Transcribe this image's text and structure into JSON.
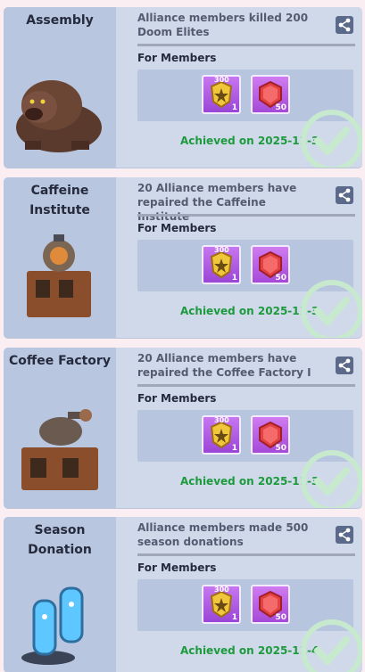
{
  "cards": [
    {
      "name": "Assembly",
      "description": "Alliance members killed 200 Doom Elites",
      "for_label": "For Members",
      "rewards": [
        {
          "icon": "badge-icon",
          "top": "300",
          "qty": "1"
        },
        {
          "icon": "red-gem-icon",
          "qty": "50"
        }
      ],
      "achieved": "Achieved on 2025-11-3"
    },
    {
      "name": "Caffeine Institute",
      "description": "20 Alliance members have repaired the Caffeine Institute",
      "for_label": "For Members",
      "rewards": [
        {
          "icon": "badge-icon",
          "top": "300",
          "qty": "1"
        },
        {
          "icon": "red-gem-icon",
          "qty": "50"
        }
      ],
      "achieved": "Achieved on 2025-11-3"
    },
    {
      "name": "Coffee Factory",
      "description": "20 Alliance members have repaired the Coffee Factory I",
      "for_label": "For Members",
      "rewards": [
        {
          "icon": "badge-icon",
          "top": "300",
          "qty": "1"
        },
        {
          "icon": "red-gem-icon",
          "qty": "50"
        }
      ],
      "achieved": "Achieved on 2025-11-3"
    },
    {
      "name": "Season Donation",
      "description": "Alliance members made 500 season donations",
      "for_label": "For Members",
      "rewards": [
        {
          "icon": "badge-icon",
          "top": "300",
          "qty": "1"
        },
        {
          "icon": "red-gem-icon",
          "qty": "50"
        }
      ],
      "achieved": "Achieved on 2025-11-4"
    }
  ],
  "colors": {
    "achieved_text": "#1d9a3c",
    "card_bg": "#cfd9ea",
    "left_bg": "#b9c6df"
  }
}
